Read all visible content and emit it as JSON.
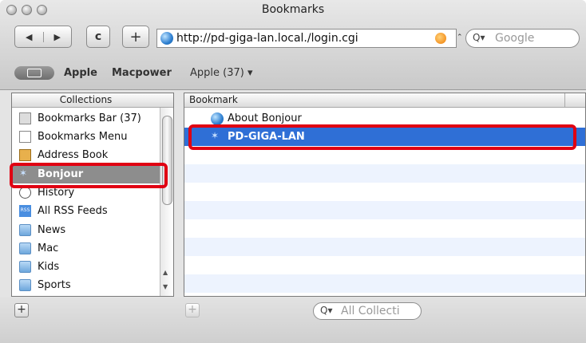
{
  "window": {
    "title": "Bookmarks"
  },
  "toolbar": {
    "back_label": "◀",
    "forward_label": "▶",
    "reload_label": "c",
    "add_label": "+",
    "url": "http://pd-giga-lan.local./login.cgi",
    "search_placeholder": "Google",
    "search_prefix": "Q▾"
  },
  "bookmarks_bar": {
    "book_icon": "open-book-icon",
    "items": [
      "Apple",
      "Macpower",
      "Apple (37) ▾"
    ]
  },
  "collections": {
    "header": "Collections",
    "items": [
      {
        "label": "Bookmarks Bar (37)",
        "icon": "bookmarks-bar-icon"
      },
      {
        "label": "Bookmarks Menu",
        "icon": "bookmarks-menu-icon"
      },
      {
        "label": "Address Book",
        "icon": "address-book-icon"
      },
      {
        "label": "Bonjour",
        "icon": "bonjour-icon",
        "selected": true
      },
      {
        "label": "History",
        "icon": "clock-icon"
      },
      {
        "label": "All RSS Feeds",
        "icon": "rss-icon"
      },
      {
        "label": "News",
        "icon": "folder-icon"
      },
      {
        "label": "Mac",
        "icon": "folder-icon"
      },
      {
        "label": "Kids",
        "icon": "folder-icon"
      },
      {
        "label": "Sports",
        "icon": "folder-icon"
      }
    ]
  },
  "bookmark_list": {
    "header": "Bookmark",
    "items": [
      {
        "label": "About Bonjour",
        "icon": "globe-icon"
      },
      {
        "label": "PD-GIGA-LAN",
        "icon": "bonjour-icon",
        "selected": true
      }
    ]
  },
  "bottom": {
    "add_collection_label": "+",
    "add_bookmark_label": "+",
    "filter_placeholder": "All Collecti",
    "filter_prefix": "Q▾"
  },
  "colors": {
    "selection": "#2f6fd6",
    "highlight_box": "#e00012",
    "stripe": "#edf3fe"
  }
}
